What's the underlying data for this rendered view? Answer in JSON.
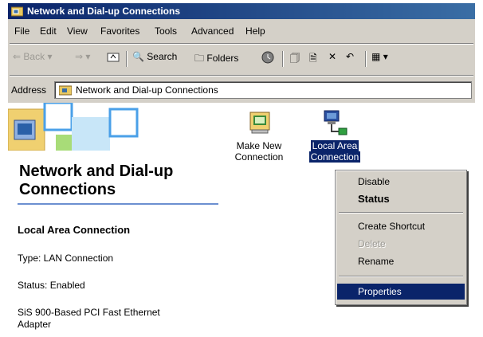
{
  "window": {
    "title": "Network and Dial-up Connections"
  },
  "menubar": {
    "items": [
      "File",
      "Edit",
      "View",
      "Favorites",
      "Tools",
      "Advanced",
      "Help"
    ]
  },
  "toolbar": {
    "back_label": "Back",
    "search_label": "Search",
    "folders_label": "Folders"
  },
  "address": {
    "label": "Address",
    "value": "Network and Dial-up Connections"
  },
  "left_panel": {
    "heading_line1": "Network and Dial-up",
    "heading_line2": "Connections",
    "selected_title": "Local Area Connection",
    "type_text": "Type: LAN Connection",
    "status_text": "Status: Enabled",
    "adapter_line1": "SiS 900-Based PCI Fast Ethernet",
    "adapter_line2": "Adapter"
  },
  "icons": {
    "make_new": {
      "line1": "Make New",
      "line2": "Connection"
    },
    "local_area": {
      "line1": "Local Area",
      "line2": "Connection"
    }
  },
  "context_menu": {
    "items": [
      "Disable",
      "Status",
      "Create Shortcut",
      "Delete",
      "Rename",
      "Properties"
    ]
  },
  "colors": {
    "titlebar": "#0a246a",
    "selection": "#0a246a",
    "chrome": "#d4d0c8"
  }
}
